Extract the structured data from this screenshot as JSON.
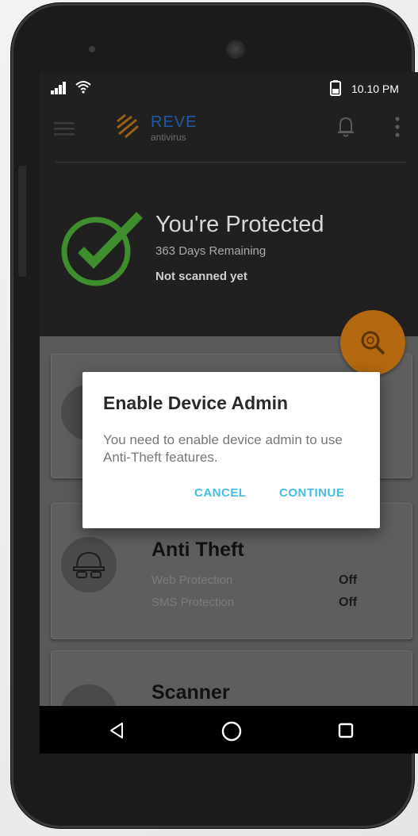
{
  "status_bar": {
    "time": "10.10 PM"
  },
  "toolbar": {
    "logo_title": "REVE",
    "logo_subtitle": "antivirus"
  },
  "protection": {
    "title": "You're Protected",
    "days_remaining": "363 Days Remaining",
    "scan_status": "Not scanned yet"
  },
  "cards": [
    {
      "title": "Anti Theft",
      "rows": [
        {
          "label": "Web Protection",
          "value": "Off"
        },
        {
          "label": "SMS Protection",
          "value": "Off"
        }
      ]
    },
    {
      "title": "Scanner"
    }
  ],
  "dialog": {
    "title": "Enable Device Admin",
    "message": "You need to enable device admin to use Anti-Theft features.",
    "cancel_label": "CANCEL",
    "continue_label": "CONTINUE"
  },
  "colors": {
    "accent_orange": "#b3680f",
    "brand_blue": "#1f5aa6",
    "check_green": "#3e8e2e",
    "dialog_button": "#44bde2"
  },
  "icons": {
    "status": [
      "signal-icon",
      "wifi-icon",
      "battery-icon"
    ],
    "toolbar": [
      "menu-icon",
      "logo-icon",
      "bell-icon",
      "more-vert-icon"
    ],
    "nav": [
      "back-icon",
      "home-icon",
      "recents-icon"
    ],
    "fab": "scan-icon"
  }
}
